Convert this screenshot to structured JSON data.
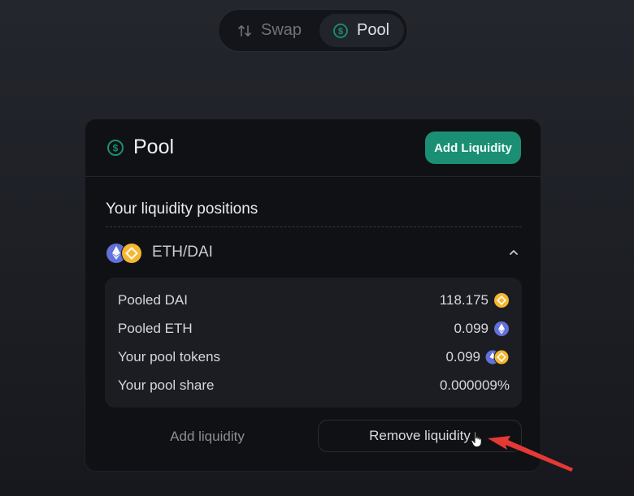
{
  "switcher": {
    "tabs": [
      {
        "label": "Swap",
        "icon": "swap-icon",
        "active": false
      },
      {
        "label": "Pool",
        "icon": "dollar-circle-icon",
        "active": true
      }
    ]
  },
  "pool_card": {
    "title": "Pool",
    "title_icon": "dollar-circle-icon",
    "add_liquidity_button": "Add Liquidity",
    "section_title": "Your liquidity positions",
    "position": {
      "pair": "ETH/DAI",
      "icons": [
        "eth-token-icon",
        "dai-token-icon"
      ],
      "expanded": true,
      "details": [
        {
          "label": "Pooled DAI",
          "value": "118.175",
          "icon": "dai-token-icon"
        },
        {
          "label": "Pooled ETH",
          "value": "0.099",
          "icon": "eth-token-icon"
        },
        {
          "label": "Your pool tokens",
          "value": "0.099",
          "icon": "pair-token-icon"
        },
        {
          "label": "Your pool share",
          "value": "0.000009%",
          "icon": ""
        }
      ],
      "add_liquidity_link": "Add liquidity",
      "remove_liquidity_button": "Remove liquidity"
    }
  },
  "colors": {
    "accent_green": "#1b8f73",
    "dai_gold": "#f4b731",
    "eth_purple": "#6270d8",
    "annotation_red": "#e53935"
  }
}
